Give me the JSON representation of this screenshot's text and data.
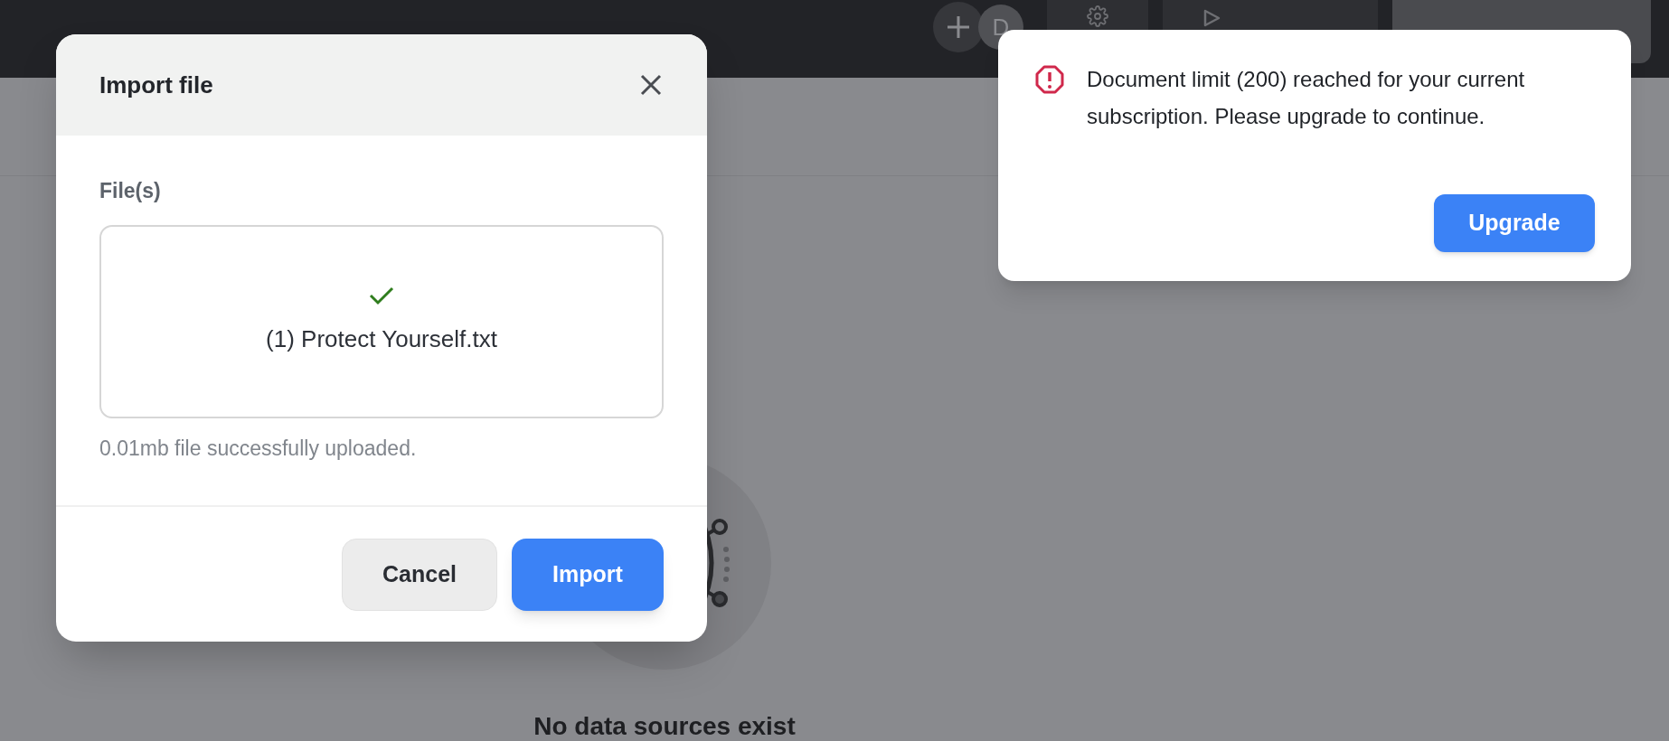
{
  "topbar": {
    "avatar_initial": "D",
    "buttons": [
      {
        "kind": "secondary"
      },
      {
        "kind": "primary"
      }
    ]
  },
  "empty_state": {
    "message": "No data sources exist"
  },
  "dialog": {
    "title": "Import file",
    "field_label": "File(s)",
    "file": {
      "name": "(1) Protect Yourself.txt",
      "uploaded": true
    },
    "helper": "0.01mb file successfully uploaded.",
    "buttons": [
      {
        "label": "Cancel",
        "kind": "secondary"
      },
      {
        "label": "Import",
        "kind": "primary"
      }
    ]
  },
  "toast": {
    "message": "Document limit (200) reached for your current subscription. Please upgrade to continue.",
    "button": "Upgrade"
  }
}
